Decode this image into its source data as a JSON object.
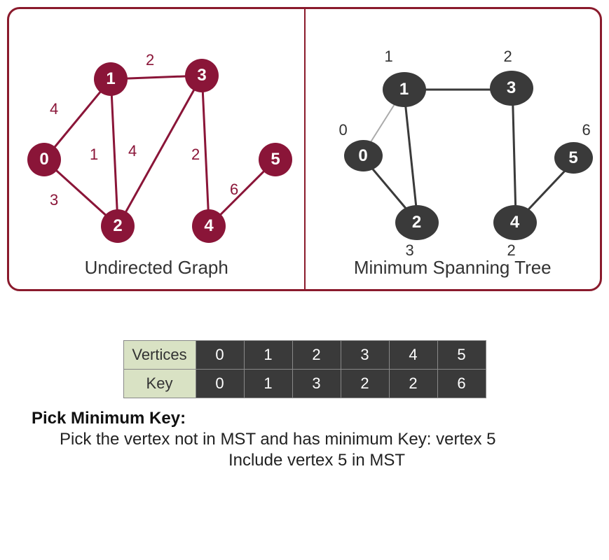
{
  "left_caption": "Undirected Graph",
  "right_caption": "Minimum Spanning Tree",
  "ug_nodes": {
    "n0": "0",
    "n1": "1",
    "n2": "2",
    "n3": "3",
    "n4": "4",
    "n5": "5"
  },
  "ug_weights": {
    "e01": "4",
    "e02": "3",
    "e12": "1",
    "e13": "2",
    "e23": "4",
    "e34": "2",
    "e45": "6"
  },
  "mst_nodes": {
    "n0": "0",
    "n1": "1",
    "n2": "2",
    "n3": "3",
    "n4": "4",
    "n5": "5"
  },
  "mst_labels": {
    "l0": "0",
    "l1": "1",
    "l2": "3",
    "l3": "2",
    "l4": "2",
    "l5": "6"
  },
  "table": {
    "row1_header": "Vertices",
    "row1": [
      "0",
      "1",
      "2",
      "3",
      "4",
      "5"
    ],
    "row2_header": "Key",
    "row2": [
      "0",
      "1",
      "3",
      "2",
      "2",
      "6"
    ]
  },
  "pick_title": "Pick Minimum Key:",
  "pick_line1": "Pick the vertex not in MST and has minimum Key: vertex 5",
  "pick_line2": "Include vertex 5 in MST"
}
